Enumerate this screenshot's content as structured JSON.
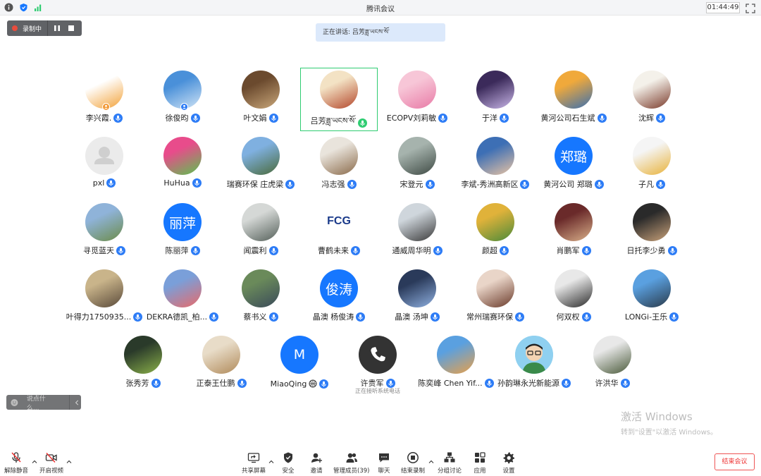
{
  "window": {
    "title": "腾讯会议",
    "timer": "01:44:49"
  },
  "recording": {
    "label": "录制中"
  },
  "speaking": {
    "text": "正在讲话: 吕芳ཟླ་ཡངས་སོ་"
  },
  "participants": [
    {
      "name": "李兴霞.",
      "avatar": "photo",
      "colors": [
        "#ffffff",
        "#f2a23a"
      ]
    },
    {
      "name": "徐俊昀",
      "avatar": "photo",
      "colors": [
        "#4a90d9",
        "#cfe3f5"
      ]
    },
    {
      "name": "叶文娟",
      "avatar": "photo",
      "colors": [
        "#6b4a2e",
        "#c9a77a"
      ]
    },
    {
      "name": "吕芳ཟླ་ཡངས་སོ་",
      "avatar": "photo",
      "colors": [
        "#f3e2c4",
        "#b3472b"
      ],
      "active": true
    },
    {
      "name": "ECOPV刘莉敏",
      "avatar": "photo",
      "colors": [
        "#f7c6d7",
        "#e87aa6"
      ]
    },
    {
      "name": "于洋",
      "avatar": "photo",
      "colors": [
        "#3b2a5a",
        "#c9b6e8"
      ]
    },
    {
      "name": "黄河公司石生斌",
      "avatar": "photo",
      "colors": [
        "#f0a93b",
        "#3a6fb0"
      ]
    },
    {
      "name": "沈辉",
      "avatar": "photo",
      "colors": [
        "#f4f1ea",
        "#7a3a2a"
      ]
    },
    {
      "name": "pxl",
      "avatar": "default",
      "colors": [
        "#ebebeb",
        "#cfcfcf"
      ]
    },
    {
      "name": "HuHua",
      "avatar": "photo",
      "colors": [
        "#e84c8b",
        "#5bc24f"
      ]
    },
    {
      "name": "瑞赛环保 庄虎梁",
      "avatar": "photo",
      "colors": [
        "#7fb0e0",
        "#4a6a3a"
      ]
    },
    {
      "name": "冯志强",
      "avatar": "photo",
      "colors": [
        "#e9e4dc",
        "#8a6a4a"
      ]
    },
    {
      "name": "宋登元",
      "avatar": "photo",
      "colors": [
        "#a6b3ad",
        "#3e4a44"
      ]
    },
    {
      "name": "李斌-秀洲高新区",
      "avatar": "photo",
      "colors": [
        "#3d6fb5",
        "#e8c3a3"
      ]
    },
    {
      "name": "黄河公司 郑璐",
      "avatar": "text",
      "text": "郑璐",
      "colors": [
        "#1677ff",
        "#1677ff"
      ]
    },
    {
      "name": "子凡",
      "avatar": "photo",
      "colors": [
        "#f5f5f5",
        "#e8b23a"
      ]
    },
    {
      "name": "寻觅蓝天",
      "avatar": "photo",
      "colors": [
        "#8fb3d9",
        "#6c8c4a"
      ]
    },
    {
      "name": "陈丽萍",
      "avatar": "text",
      "text": "丽萍",
      "colors": [
        "#1677ff",
        "#1677ff"
      ]
    },
    {
      "name": "闻震利",
      "avatar": "photo",
      "colors": [
        "#d5d8d6",
        "#55605a"
      ]
    },
    {
      "name": "曹鹤未来",
      "avatar": "logo",
      "text": "FCG",
      "colors": [
        "#ffffff",
        "#1a3a8a"
      ]
    },
    {
      "name": "通威周华明",
      "avatar": "photo",
      "colors": [
        "#cfd6dc",
        "#3a3a3a"
      ]
    },
    {
      "name": "颜超",
      "avatar": "photo",
      "colors": [
        "#e0b23a",
        "#4a8a3a"
      ]
    },
    {
      "name": "肖鹏军",
      "avatar": "photo",
      "colors": [
        "#6a2a2a",
        "#d9b08a"
      ]
    },
    {
      "name": "日托李少勇",
      "avatar": "photo",
      "colors": [
        "#2a2a2a",
        "#c9a27a"
      ]
    },
    {
      "name": "叶得力1750935...",
      "avatar": "photo",
      "colors": [
        "#c9b48a",
        "#5a4a3a"
      ]
    },
    {
      "name": "DEKRA德凯_柏...",
      "avatar": "photo",
      "colors": [
        "#7a9fd9",
        "#e86a6a"
      ]
    },
    {
      "name": "蔡书义",
      "avatar": "photo",
      "colors": [
        "#6a8a5a",
        "#3a4a5a"
      ]
    },
    {
      "name": "晶澳 杨俊涛",
      "avatar": "text",
      "text": "俊涛",
      "colors": [
        "#1677ff",
        "#1677ff"
      ]
    },
    {
      "name": "晶澳 汤坤",
      "avatar": "photo",
      "colors": [
        "#2a3a5a",
        "#8fb0e0"
      ]
    },
    {
      "name": "常州瑞赛环保",
      "avatar": "photo",
      "colors": [
        "#e9d5c8",
        "#6a3a2a"
      ]
    },
    {
      "name": "何双权",
      "avatar": "photo",
      "colors": [
        "#e8e8e8",
        "#2a2a2a"
      ]
    },
    {
      "name": "LONGi-王乐",
      "avatar": "photo",
      "colors": [
        "#5aa0e0",
        "#2a3a4a"
      ]
    },
    {
      "name": "张秀芳",
      "avatar": "photo",
      "colors": [
        "#2a3a2a",
        "#8ab04a"
      ]
    },
    {
      "name": "正泰王仕鹏",
      "avatar": "photo",
      "colors": [
        "#e8dcc8",
        "#b08a5a"
      ]
    },
    {
      "name": "MiaoQing",
      "avatar": "text",
      "text": "M",
      "colors": [
        "#1677ff",
        "#1677ff"
      ],
      "status_icon": "basketball"
    },
    {
      "name": "许贵军",
      "avatar": "phone",
      "colors": [
        "#333333",
        "#333333"
      ],
      "note": "正在接听系统电话"
    },
    {
      "name": "陈奕峰 Chen Yif...",
      "avatar": "photo",
      "colors": [
        "#5aa0e0",
        "#e8a04a"
      ]
    },
    {
      "name": "孙韵琳永光新能源",
      "avatar": "cartoon",
      "colors": [
        "#8fd0f0",
        "#3a8a4a"
      ]
    },
    {
      "name": "许洪华",
      "avatar": "photo",
      "colors": [
        "#e8e8e8",
        "#4a5a3a"
      ]
    }
  ],
  "chat": {
    "placeholder": "说点什么..."
  },
  "watermark": {
    "line1": "激活 Windows",
    "line2": "转到\"设置\"以激活 Windows。"
  },
  "toolbar": {
    "unmute": "解除静音",
    "video": "开启视频",
    "share": "共享屏幕",
    "security": "安全",
    "invite": "邀请",
    "members": "管理成员(39)",
    "chat": "聊天",
    "end_record": "结束录制",
    "breakout": "分组讨论",
    "apps": "应用",
    "settings": "设置",
    "end_meeting": "结束会议"
  },
  "colors": {
    "accent": "#2d7cf6",
    "active_border": "#2ecc71",
    "end_red": "#e53333"
  }
}
